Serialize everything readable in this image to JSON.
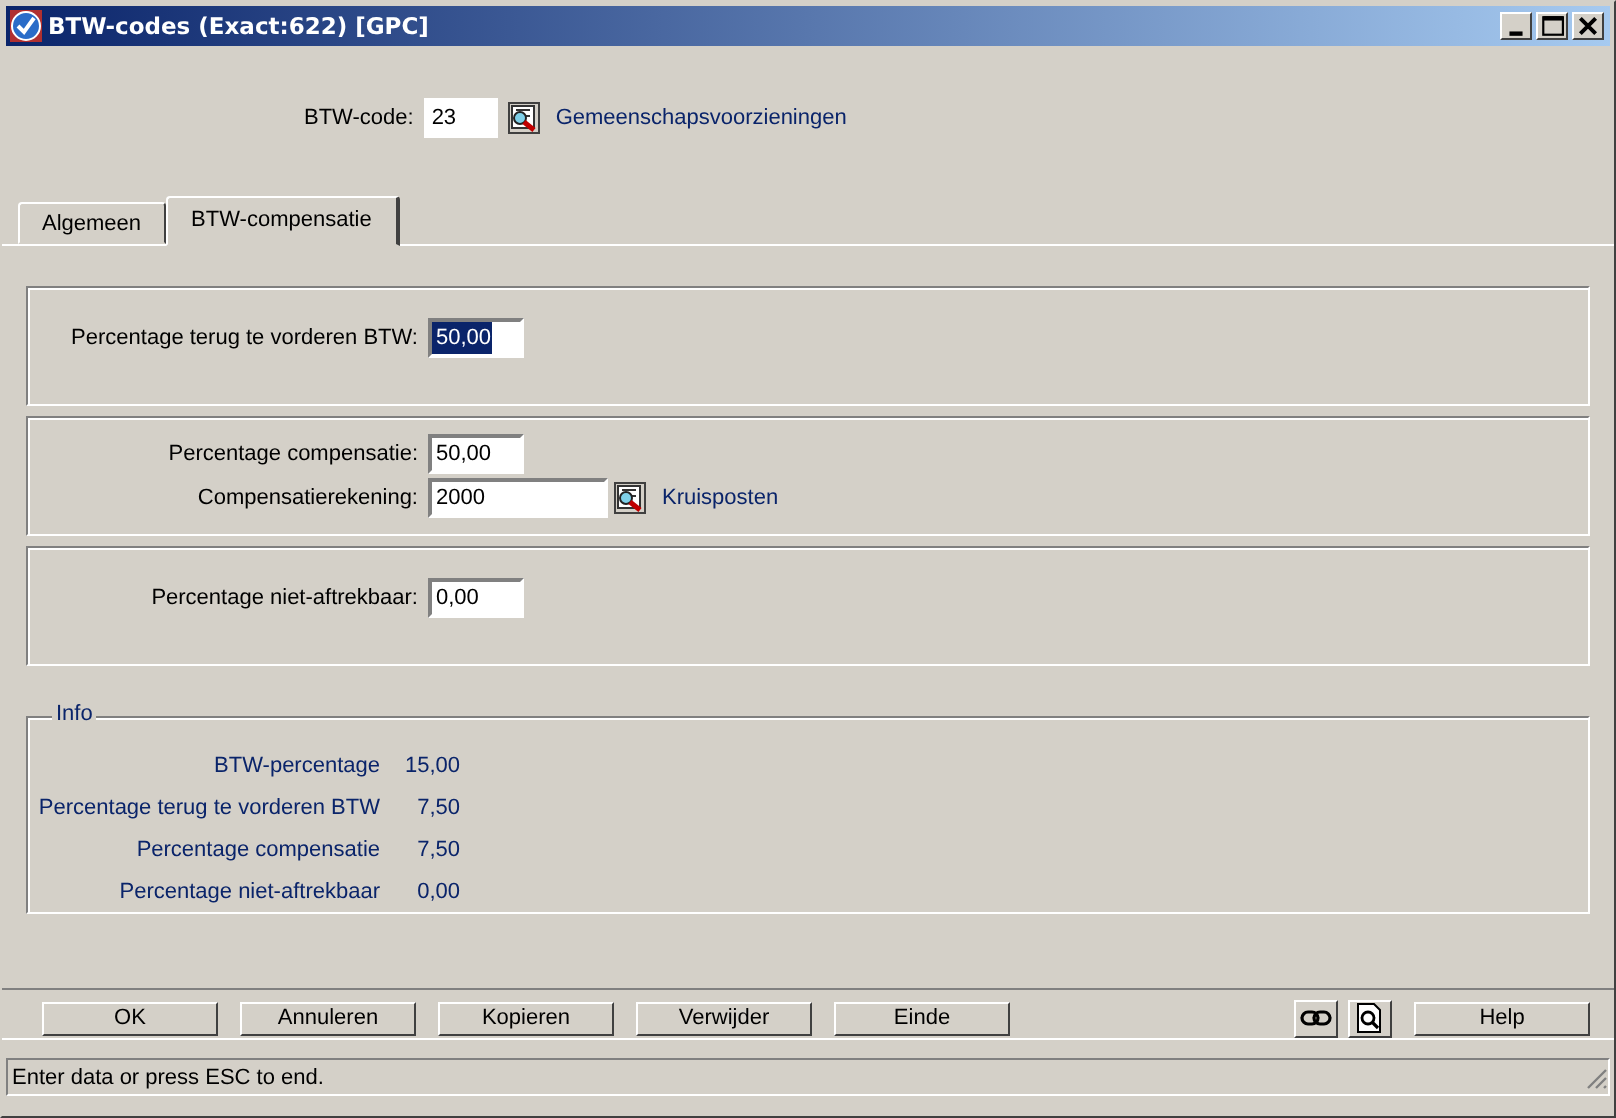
{
  "window": {
    "title": "BTW-codes (Exact:622) [GPC]"
  },
  "header": {
    "label": "BTW-code:",
    "value": "23",
    "link": "Gemeenschapsvoorzieningen"
  },
  "tabs": [
    {
      "label": "Algemeen",
      "selected": false
    },
    {
      "label": "BTW-compensatie",
      "selected": true
    }
  ],
  "groups": [
    {
      "fields": [
        {
          "label": "Percentage terug te vorderen BTW:",
          "value": "50,00",
          "selected": true
        }
      ]
    },
    {
      "fields": [
        {
          "label": "Percentage compensatie:",
          "value": "50,00",
          "selected": false
        },
        {
          "label": "Compensatierekening:",
          "value": "2000",
          "selected": false,
          "wide": true,
          "link": "Kruisposten"
        }
      ]
    },
    {
      "fields": [
        {
          "label": "Percentage niet-aftrekbaar:",
          "value": "0,00",
          "selected": false
        }
      ]
    }
  ],
  "info": {
    "title": "Info",
    "rows": [
      {
        "label": "BTW-percentage",
        "value": "15,00"
      },
      {
        "label": "Percentage terug te vorderen BTW",
        "value": "7,50"
      },
      {
        "label": "Percentage compensatie",
        "value": "7,50"
      },
      {
        "label": "Percentage niet-aftrekbaar",
        "value": "0,00"
      }
    ]
  },
  "buttons": [
    "OK",
    "Annuleren",
    "Kopieren",
    "Verwijder",
    "Einde"
  ],
  "help_button": "Help",
  "status_bar": "Enter data or press ESC to end."
}
